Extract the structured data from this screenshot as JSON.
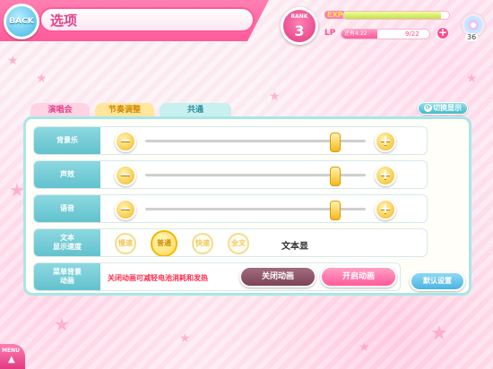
{
  "header": {
    "back_label": "BACK",
    "title": "选项"
  },
  "status": {
    "rank_label": "RANK",
    "rank_value": "3",
    "exp_label": "EXP",
    "exp_fraction": 0.92,
    "lp_label": "LP",
    "lp_note": "还有4:22",
    "lp_count": "9/22",
    "lp_fraction": 0.41,
    "lp_plus": "+",
    "disc_count": "36"
  },
  "toggle_display_label": "切换显示",
  "tabs": [
    {
      "label": "演唱会"
    },
    {
      "label": "节奏调整"
    },
    {
      "label": "共通"
    }
  ],
  "settings": {
    "bgm": {
      "label": "背景乐",
      "level": 0.86
    },
    "se": {
      "label": "声效",
      "level": 0.86
    },
    "voice": {
      "label": "语音",
      "level": 0.86
    },
    "text_speed": {
      "label": "文本\n显示速度",
      "options": [
        "慢速",
        "普通",
        "快速",
        "全文"
      ],
      "selected": "普通",
      "preview": "文本显"
    },
    "menu_bg_anim": {
      "label": "菜单背景\n动画",
      "note": "关闭动画可减轻电池消耗和发热",
      "off_label": "关闭动画",
      "on_label": "开启动画"
    }
  },
  "minus_symbol": "−",
  "plus_symbol": "+",
  "default_label": "默认设置",
  "menu_label": "MENU",
  "menu_arrow": "▲"
}
